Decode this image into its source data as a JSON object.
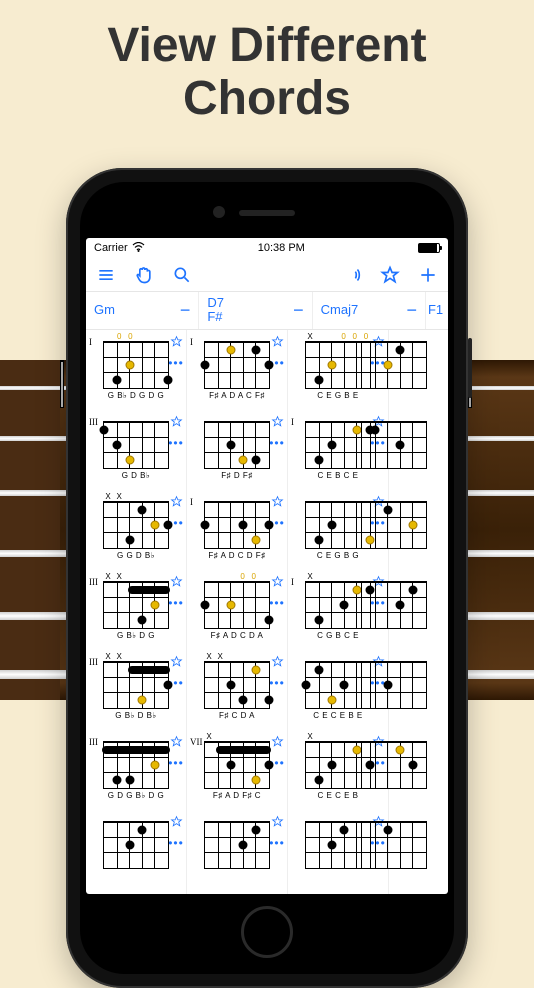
{
  "headline_l1": "View Different",
  "headline_l2": "Chords",
  "status": {
    "carrier": "Carrier",
    "time": "10:38 PM"
  },
  "columns": [
    {
      "name": "Gm"
    },
    {
      "name": "D7\nF#"
    },
    {
      "name": "Cmaj7"
    },
    {
      "name": "F1"
    }
  ],
  "cards": {
    "c0": [
      {
        "pos": "I",
        "open": [
          "",
          "0",
          "0",
          "",
          "",
          ""
        ],
        "notes": "G B♭ D G D G",
        "dots": [
          {
            "s": 5,
            "f": 3,
            "c": "b"
          },
          {
            "s": 1,
            "f": 3,
            "c": "b"
          },
          {
            "s": 4,
            "f": 2,
            "c": "y"
          }
        ]
      },
      {
        "pos": "III",
        "open": [
          "",
          "",
          "",
          "",
          "",
          ""
        ],
        "notes": "G D B♭",
        "dots": [
          {
            "s": 6,
            "f": 1,
            "c": "b"
          },
          {
            "s": 5,
            "f": 2,
            "c": "b"
          },
          {
            "s": 4,
            "f": 3,
            "c": "y"
          }
        ]
      },
      {
        "pos": "",
        "open": [
          "X",
          "X",
          "",
          "",
          "",
          ""
        ],
        "notes": "G G D B♭",
        "dots": [
          {
            "s": 3,
            "f": 1,
            "c": "b"
          },
          {
            "s": 2,
            "f": 2,
            "c": "y"
          },
          {
            "s": 1,
            "f": 2,
            "c": "b"
          },
          {
            "s": 4,
            "f": 3,
            "c": "b"
          }
        ]
      },
      {
        "pos": "III",
        "open": [
          "X",
          "X",
          "",
          "",
          "",
          ""
        ],
        "notes": "G B♭ D G",
        "barre": {
          "from": 1,
          "to": 4,
          "f": 1
        },
        "dots": [
          {
            "s": 2,
            "f": 2,
            "c": "y"
          },
          {
            "s": 3,
            "f": 3,
            "c": "b"
          }
        ]
      },
      {
        "pos": "III",
        "open": [
          "X",
          "X",
          "",
          "",
          "",
          ""
        ],
        "notes": "G B♭ D B♭",
        "barre": {
          "from": 1,
          "to": 4,
          "f": 1
        },
        "dots": [
          {
            "s": 1,
            "f": 2,
            "c": "b"
          },
          {
            "s": 3,
            "f": 3,
            "c": "y"
          }
        ]
      },
      {
        "pos": "III",
        "open": [
          "",
          "",
          "",
          "",
          "",
          ""
        ],
        "notes": "G D G B♭ D G",
        "barre": {
          "from": 1,
          "to": 6,
          "f": 1
        },
        "dots": [
          {
            "s": 5,
            "f": 3,
            "c": "b"
          },
          {
            "s": 4,
            "f": 3,
            "c": "b"
          },
          {
            "s": 2,
            "f": 2,
            "c": "y"
          }
        ]
      },
      {
        "pos": "",
        "open": [
          "",
          "",
          "",
          "",
          "",
          ""
        ],
        "notes": "",
        "dots": [
          {
            "s": 3,
            "f": 1,
            "c": "b"
          },
          {
            "s": 4,
            "f": 2,
            "c": "b"
          }
        ]
      }
    ],
    "c1": [
      {
        "pos": "I",
        "open": [
          "",
          "",
          "",
          "",
          "",
          ""
        ],
        "notes": "F♯ A D A C F♯",
        "dots": [
          {
            "s": 6,
            "f": 2,
            "c": "b"
          },
          {
            "s": 4,
            "f": 1,
            "c": "y"
          },
          {
            "s": 2,
            "f": 1,
            "c": "b"
          },
          {
            "s": 1,
            "f": 2,
            "c": "b"
          }
        ]
      },
      {
        "pos": "",
        "open": [
          "",
          "",
          "",
          "",
          "",
          ""
        ],
        "notes": "F♯ D F♯",
        "dots": [
          {
            "s": 4,
            "f": 2,
            "c": "b"
          },
          {
            "s": 3,
            "f": 3,
            "c": "y"
          },
          {
            "s": 2,
            "f": 3,
            "c": "b"
          }
        ]
      },
      {
        "pos": "I",
        "open": [
          "",
          "",
          "",
          "",
          "",
          ""
        ],
        "notes": "F♯ A D C D F♯",
        "dots": [
          {
            "s": 6,
            "f": 2,
            "c": "b"
          },
          {
            "s": 3,
            "f": 2,
            "c": "b"
          },
          {
            "s": 2,
            "f": 3,
            "c": "y"
          },
          {
            "s": 1,
            "f": 2,
            "c": "b"
          }
        ]
      },
      {
        "pos": "",
        "open": [
          "",
          "",
          "",
          "0",
          "0",
          ""
        ],
        "notes": "F♯ A D C D A",
        "dots": [
          {
            "s": 6,
            "f": 2,
            "c": "b"
          },
          {
            "s": 4,
            "f": 2,
            "c": "y"
          },
          {
            "s": 1,
            "f": 3,
            "c": "b"
          }
        ]
      },
      {
        "pos": "",
        "open": [
          "X",
          "X",
          "",
          "",
          "",
          ""
        ],
        "notes": "F♯ C D A",
        "dots": [
          {
            "s": 4,
            "f": 2,
            "c": "b"
          },
          {
            "s": 3,
            "f": 3,
            "c": "b"
          },
          {
            "s": 2,
            "f": 1,
            "c": "y"
          },
          {
            "s": 1,
            "f": 3,
            "c": "b"
          }
        ]
      },
      {
        "pos": "VII",
        "open": [
          "X",
          "",
          "",
          "",
          "",
          ""
        ],
        "notes": "F♯ A D F♯ C",
        "barre": {
          "from": 1,
          "to": 5,
          "f": 1
        },
        "dots": [
          {
            "s": 4,
            "f": 2,
            "c": "b"
          },
          {
            "s": 2,
            "f": 3,
            "c": "y"
          },
          {
            "s": 1,
            "f": 2,
            "c": "b"
          }
        ]
      },
      {
        "pos": "",
        "open": [
          "",
          "",
          "",
          "",
          "",
          ""
        ],
        "notes": "",
        "dots": [
          {
            "s": 3,
            "f": 2,
            "c": "b"
          },
          {
            "s": 2,
            "f": 1,
            "c": "b"
          }
        ]
      }
    ],
    "c2": [
      {
        "pos": "",
        "open": [
          "X",
          "",
          "",
          "0",
          "0",
          "0"
        ],
        "notes": "C E G B E",
        "dots": [
          {
            "s": 5,
            "f": 3,
            "c": "b"
          },
          {
            "s": 4,
            "f": 2,
            "c": "y"
          }
        ]
      },
      {
        "pos": "I",
        "open": [
          "",
          "",
          "",
          "",
          "",
          ""
        ],
        "notes": "C E B C E",
        "dots": [
          {
            "s": 5,
            "f": 3,
            "c": "b"
          },
          {
            "s": 4,
            "f": 2,
            "c": "b"
          },
          {
            "s": 2,
            "f": 1,
            "c": "y"
          },
          {
            "s": 1,
            "f": 1,
            "c": "b"
          }
        ]
      },
      {
        "pos": "",
        "open": [
          "",
          "",
          "",
          "",
          "",
          ""
        ],
        "notes": "C E G B G",
        "dots": [
          {
            "s": 5,
            "f": 3,
            "c": "b"
          },
          {
            "s": 4,
            "f": 2,
            "c": "b"
          },
          {
            "s": 1,
            "f": 3,
            "c": "y"
          }
        ]
      },
      {
        "pos": "I",
        "open": [
          "X",
          "",
          "",
          "",
          "",
          ""
        ],
        "notes": "C G B C E",
        "dots": [
          {
            "s": 5,
            "f": 3,
            "c": "b"
          },
          {
            "s": 3,
            "f": 2,
            "c": "b"
          },
          {
            "s": 2,
            "f": 1,
            "c": "y"
          },
          {
            "s": 1,
            "f": 1,
            "c": "b"
          }
        ]
      },
      {
        "pos": "",
        "open": [
          "",
          "",
          "",
          "",
          "",
          ""
        ],
        "notes": "C E C E B E",
        "dots": [
          {
            "s": 6,
            "f": 2,
            "c": "b"
          },
          {
            "s": 5,
            "f": 1,
            "c": "b"
          },
          {
            "s": 4,
            "f": 3,
            "c": "y"
          },
          {
            "s": 3,
            "f": 2,
            "c": "b"
          }
        ]
      },
      {
        "pos": "",
        "open": [
          "X",
          "",
          "",
          "",
          "",
          ""
        ],
        "notes": "C E C E B",
        "dots": [
          {
            "s": 5,
            "f": 3,
            "c": "b"
          },
          {
            "s": 4,
            "f": 2,
            "c": "b"
          },
          {
            "s": 2,
            "f": 1,
            "c": "y"
          },
          {
            "s": 1,
            "f": 2,
            "c": "b"
          }
        ]
      },
      {
        "pos": "",
        "open": [
          "",
          "",
          "",
          "",
          "",
          ""
        ],
        "notes": "",
        "dots": [
          {
            "s": 4,
            "f": 2,
            "c": "b"
          },
          {
            "s": 3,
            "f": 1,
            "c": "b"
          }
        ]
      }
    ],
    "c3": [
      {
        "pos": "",
        "open": [
          "",
          "",
          "",
          "",
          "",
          ""
        ],
        "notes": "",
        "dots": [
          {
            "s": 4,
            "f": 2,
            "c": "y"
          },
          {
            "s": 3,
            "f": 1,
            "c": "b"
          }
        ]
      },
      {
        "pos": "",
        "open": [
          "",
          "",
          "",
          "",
          "",
          ""
        ],
        "notes": "",
        "dots": [
          {
            "s": 5,
            "f": 1,
            "c": "b"
          },
          {
            "s": 3,
            "f": 2,
            "c": "b"
          }
        ]
      },
      {
        "pos": "",
        "open": [
          "",
          "",
          "",
          "",
          "",
          ""
        ],
        "notes": "",
        "dots": [
          {
            "s": 4,
            "f": 1,
            "c": "b"
          },
          {
            "s": 2,
            "f": 2,
            "c": "y"
          }
        ]
      },
      {
        "pos": "",
        "open": [
          "",
          "",
          "",
          "",
          "",
          ""
        ],
        "notes": "",
        "dots": [
          {
            "s": 3,
            "f": 2,
            "c": "b"
          },
          {
            "s": 2,
            "f": 1,
            "c": "b"
          }
        ]
      },
      {
        "pos": "",
        "open": [
          "",
          "",
          "",
          "",
          "",
          ""
        ],
        "notes": "",
        "dots": [
          {
            "s": 4,
            "f": 2,
            "c": "b"
          }
        ]
      },
      {
        "pos": "",
        "open": [
          "",
          "",
          "",
          "",
          "",
          ""
        ],
        "notes": "",
        "dots": [
          {
            "s": 3,
            "f": 1,
            "c": "y"
          },
          {
            "s": 2,
            "f": 2,
            "c": "b"
          }
        ]
      },
      {
        "pos": "",
        "open": [
          "",
          "",
          "",
          "",
          "",
          ""
        ],
        "notes": "",
        "dots": [
          {
            "s": 4,
            "f": 1,
            "c": "b"
          }
        ]
      }
    ]
  }
}
